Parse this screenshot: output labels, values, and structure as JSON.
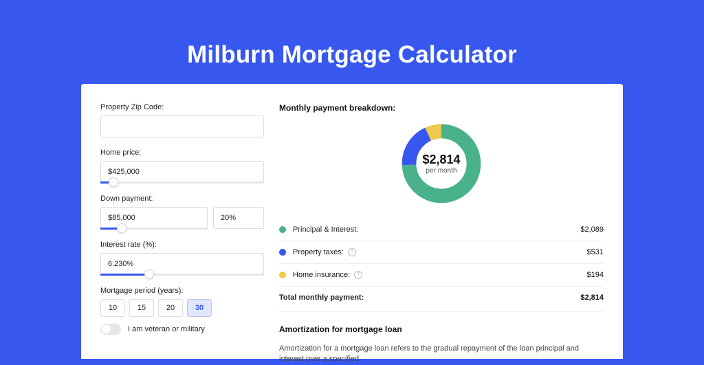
{
  "title": "Milburn Mortgage Calculator",
  "form": {
    "zip_label": "Property Zip Code:",
    "zip_value": "",
    "home_price_label": "Home price:",
    "home_price_value": "$425,000",
    "home_price_slider_pct": 8,
    "down_payment_label": "Down payment:",
    "down_payment_amount": "$85,000",
    "down_payment_pct": "20%",
    "down_payment_slider_pct": 20,
    "interest_label": "Interest rate (%):",
    "interest_value": "6.230%",
    "interest_slider_pct": 30,
    "period_label": "Mortgage period (years):",
    "periods": [
      "10",
      "15",
      "20",
      "30"
    ],
    "period_selected": "30",
    "veteran_label": "I am veteran or military",
    "veteran_on": false
  },
  "breakdown": {
    "title": "Monthly payment breakdown:",
    "center_amount": "$2,814",
    "center_sub": "per month",
    "items": [
      {
        "key": "pi",
        "label": "Principal & Interest:",
        "value": "$2,089",
        "color": "#49b28a",
        "info": false
      },
      {
        "key": "tax",
        "label": "Property taxes:",
        "value": "$531",
        "color": "#3757ef",
        "info": true
      },
      {
        "key": "ins",
        "label": "Home insurance:",
        "value": "$194",
        "color": "#efc94c",
        "info": true
      }
    ],
    "total_label": "Total monthly payment:",
    "total_value": "$2,814"
  },
  "chart_data": {
    "type": "pie",
    "title": "Monthly payment breakdown",
    "series": [
      {
        "name": "Principal & Interest",
        "value": 2089,
        "color": "#49b28a"
      },
      {
        "name": "Property taxes",
        "value": 531,
        "color": "#3757ef"
      },
      {
        "name": "Home insurance",
        "value": 194,
        "color": "#efc94c"
      }
    ],
    "total": 2814,
    "center_label": "$2,814 per month"
  },
  "amortization": {
    "title": "Amortization for mortgage loan",
    "text": "Amortization for a mortgage loan refers to the gradual repayment of the loan principal and interest over a specified"
  }
}
